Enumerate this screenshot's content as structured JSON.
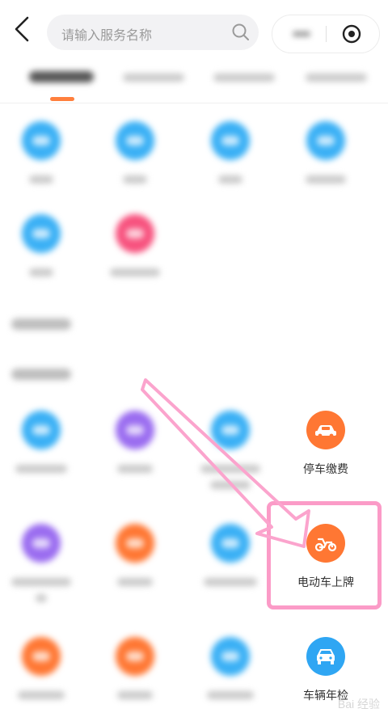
{
  "header": {
    "search_placeholder": "请输入服务名称"
  },
  "visible_items": {
    "parking_fee": "停车缴费",
    "ebike_plate": "电动车上牌",
    "vehicle_inspection": "车辆年检"
  },
  "colors": {
    "accent": "#ff7f3d",
    "highlight": "#fb9bc7",
    "blue_icon": "#3ab0f5",
    "purple_icon": "#9a6cf0",
    "orange_icon": "#ff7733",
    "pink_icon": "#f7527e"
  },
  "icons": {
    "back": "chevron-left-icon",
    "search": "search-icon",
    "more": "more-dots-icon",
    "target": "target-icon",
    "car": "car-icon",
    "scooter": "scooter-icon",
    "vehicle_front": "car-front-icon"
  }
}
